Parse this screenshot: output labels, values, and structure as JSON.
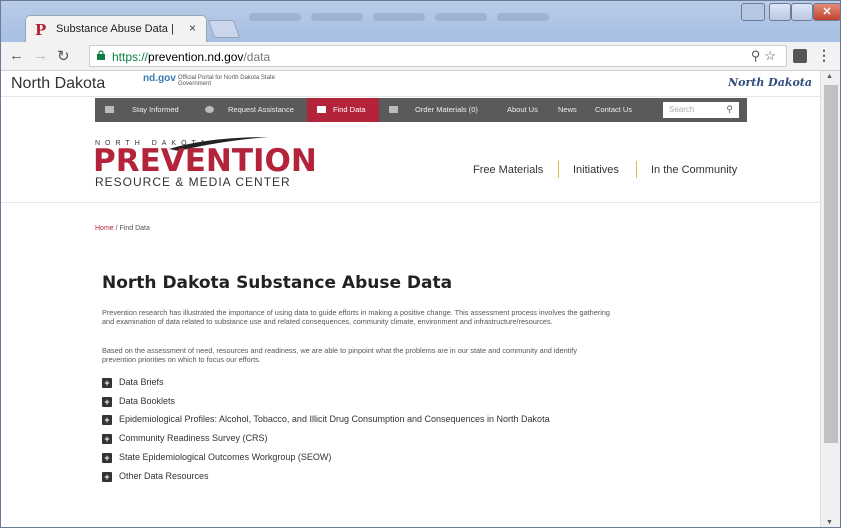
{
  "browser": {
    "tab_title": "Substance Abuse Data | ",
    "tab_close": "×",
    "url_proto": "https://",
    "url_host": "prevention.nd.gov",
    "url_path": "/data"
  },
  "ndgov": {
    "state_name": "North Dakota",
    "gov_label": "nd.gov",
    "portal_text": "Official Portal for North Dakota State Government",
    "logo_text": "North Dakota"
  },
  "topnav": {
    "stay_informed": "Stay Informed",
    "request_assistance": "Request Assistance",
    "find_data": "Find Data",
    "order_materials": "Order Materials (0)",
    "about_us": "About Us",
    "news": "News",
    "contact_us": "Contact Us",
    "search_placeholder": "Search"
  },
  "logo": {
    "top": "NORTH DAKOTA",
    "main": "PREVENTION",
    "sub": "RESOURCE & MEDIA CENTER"
  },
  "mainnav": {
    "free_materials": "Free Materials",
    "initiatives": "Initiatives",
    "in_the_community": "In the Community"
  },
  "breadcrumb": {
    "home": "Home",
    "separator": " / ",
    "current": "Find Data"
  },
  "content": {
    "title": "North Dakota Substance Abuse Data",
    "paragraph1": "Prevention research has illustrated the importance of using data to guide efforts in making a positive change. This assessment process involves the gathering and examination of data related to substance use and related consequences, community climate, environment and infrastructure/resources.",
    "paragraph2": "Based on the assessment of need, resources and readiness, we are able to pinpoint what the problems are in our state and community and identify prevention priorities on which to focus our efforts.",
    "accordion": [
      "Data Briefs",
      "Data Booklets",
      "Epidemiological Profiles: Alcohol, Tobacco, and Illicit Drug Consumption and Consequences in North Dakota",
      "Community Readiness Survey (CRS)",
      "State Epidemiological Outcomes Workgroup (SEOW)",
      "Other Data Resources"
    ]
  },
  "colors": {
    "brand_red": "#b3243a",
    "nav_gray": "#5a5a5a",
    "accent_gold": "#e9b54f"
  }
}
